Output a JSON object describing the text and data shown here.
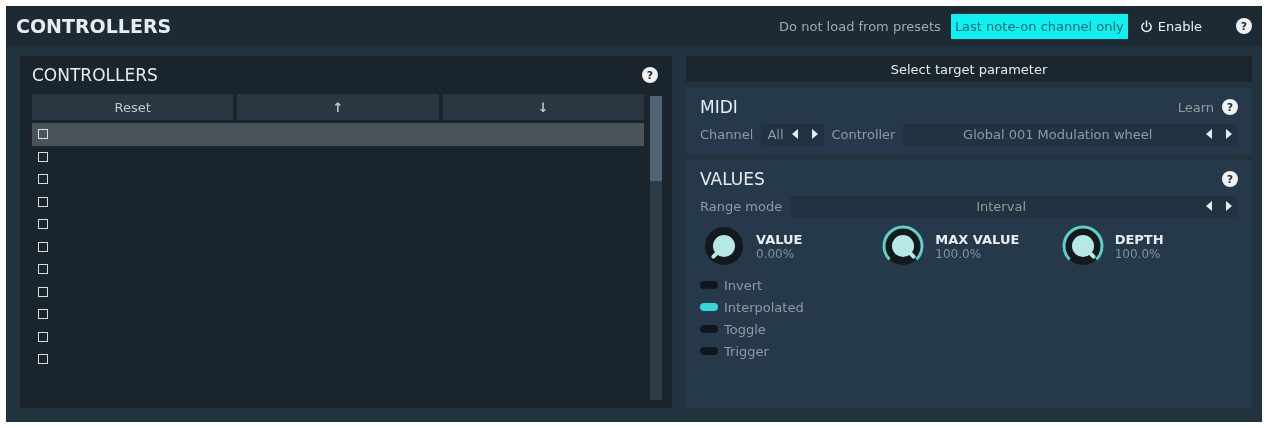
{
  "title": "CONTROLLERS",
  "header_toggles": [
    {
      "label": "Do not load from presets",
      "on": false
    },
    {
      "label": "Last note-on channel only",
      "on": true
    }
  ],
  "enable": {
    "label": "Enable",
    "on": true
  },
  "help": "?",
  "list_panel": {
    "title": "CONTROLLERS",
    "help": "?",
    "buttons": [
      "Reset",
      "↑",
      "↓"
    ],
    "rows": [
      {
        "checked": false,
        "selected": true
      },
      {
        "checked": false,
        "selected": false
      },
      {
        "checked": false,
        "selected": false
      },
      {
        "checked": false,
        "selected": false
      },
      {
        "checked": false,
        "selected": false
      },
      {
        "checked": false,
        "selected": false
      },
      {
        "checked": false,
        "selected": false
      },
      {
        "checked": false,
        "selected": false
      },
      {
        "checked": false,
        "selected": false
      },
      {
        "checked": false,
        "selected": false
      },
      {
        "checked": false,
        "selected": false
      }
    ]
  },
  "target_button": "Select target parameter",
  "midi": {
    "title": "MIDI",
    "learn": "Learn",
    "help": "?",
    "channel_label": "Channel",
    "channel_value": "All",
    "controller_label": "Controller",
    "controller_value": "Global 001 Modulation wheel"
  },
  "values": {
    "title": "VALUES",
    "help": "?",
    "range_label": "Range mode",
    "range_value": "Interval",
    "knobs": [
      {
        "label": "VALUE",
        "reading": "0.00%"
      },
      {
        "label": "MAX VALUE",
        "reading": "100.0%"
      },
      {
        "label": "DEPTH",
        "reading": "100.0%"
      }
    ],
    "switches": [
      {
        "label": "Invert",
        "on": false
      },
      {
        "label": "Interpolated",
        "on": true
      },
      {
        "label": "Toggle",
        "on": false
      },
      {
        "label": "Trigger",
        "on": false
      }
    ]
  }
}
